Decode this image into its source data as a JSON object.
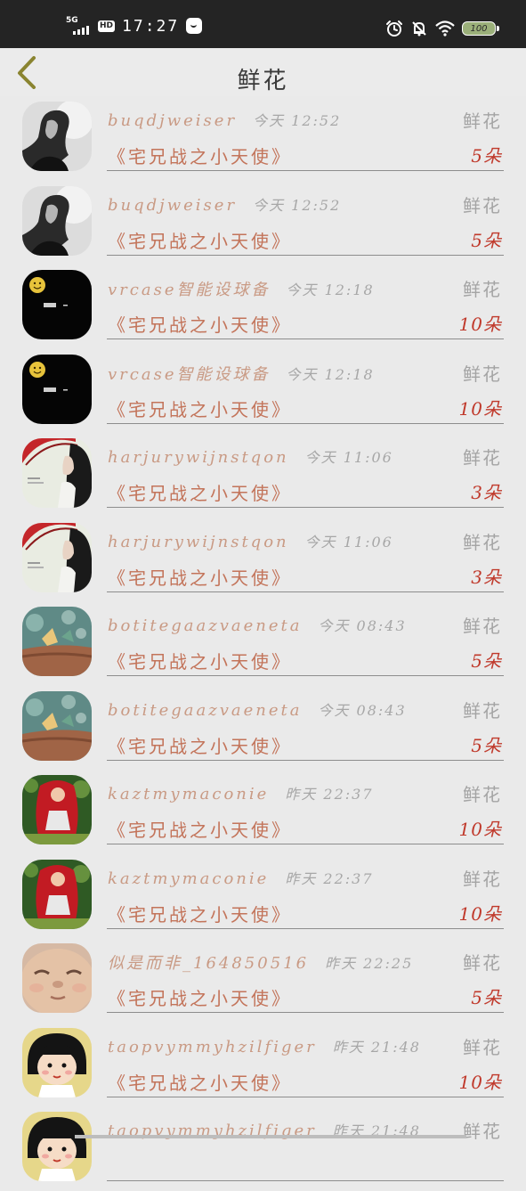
{
  "status_bar": {
    "network": "5G",
    "hd": "HD",
    "time": "17:27",
    "battery": "100",
    "icons": [
      "signal-icon",
      "hd-icon",
      "message-icon",
      "alarm-icon",
      "notifications-off-icon",
      "wifi-icon",
      "battery-icon"
    ]
  },
  "header": {
    "title": "鲜花",
    "back_icon": "chevron-left-icon"
  },
  "colors": {
    "name": "#c99a84",
    "gift_name": "#c3745a",
    "count": "#c0392b",
    "meta": "#a7a7a7",
    "back_icon": "#8a8430"
  },
  "rows": [
    {
      "avatar": "bw-portrait",
      "name": "buqdjweiser",
      "time": "今天 12:52",
      "type": "鲜花",
      "gift": "《宅兄战之小天使》",
      "count": "5朵"
    },
    {
      "avatar": "bw-portrait",
      "name": "buqdjweiser",
      "time": "今天 12:52",
      "type": "鲜花",
      "gift": "《宅兄战之小天使》",
      "count": "5朵"
    },
    {
      "avatar": "black-emoji",
      "name": "vrcase智能设球备",
      "time": "今天 12:18",
      "type": "鲜花",
      "gift": "《宅兄战之小天使》",
      "count": "10朵"
    },
    {
      "avatar": "black-emoji",
      "name": "vrcase智能设球备",
      "time": "今天 12:18",
      "type": "鲜花",
      "gift": "《宅兄战之小天使》",
      "count": "10朵"
    },
    {
      "avatar": "girl-red-umbrella",
      "name": "harjurywijnstqon",
      "time": "今天 11:06",
      "type": "鲜花",
      "gift": "《宅兄战之小天使》",
      "count": "3朵"
    },
    {
      "avatar": "girl-red-umbrella",
      "name": "harjurywijnstqon",
      "time": "今天 11:06",
      "type": "鲜花",
      "gift": "《宅兄战之小天使》",
      "count": "3朵"
    },
    {
      "avatar": "teal-bokeh",
      "name": "botitegaazvaeneta",
      "time": "今天 08:43",
      "type": "鲜花",
      "gift": "《宅兄战之小天使》",
      "count": "5朵"
    },
    {
      "avatar": "teal-bokeh",
      "name": "botitegaazvaeneta",
      "time": "今天 08:43",
      "type": "鲜花",
      "gift": "《宅兄战之小天使》",
      "count": "5朵"
    },
    {
      "avatar": "red-riding-hood",
      "name": "kaztmymaconie",
      "time": "昨天 22:37",
      "type": "鲜花",
      "gift": "《宅兄战之小天使》",
      "count": "10朵"
    },
    {
      "avatar": "red-riding-hood",
      "name": "kaztmymaconie",
      "time": "昨天 22:37",
      "type": "鲜花",
      "gift": "《宅兄战之小天使》",
      "count": "10朵"
    },
    {
      "avatar": "baby-face",
      "name": "似是而非_164850516",
      "time": "昨天 22:25",
      "type": "鲜花",
      "gift": "《宅兄战之小天使》",
      "count": "5朵"
    },
    {
      "avatar": "cartoon-girl",
      "name": "taopvymmyhzilfiger",
      "time": "昨天 21:48",
      "type": "鲜花",
      "gift": "《宅兄战之小天使》",
      "count": "10朵"
    },
    {
      "avatar": "cartoon-girl",
      "name": "taopvymmyhzilfiger",
      "time": "昨天 21:48",
      "type": "鲜花",
      "gift": "",
      "count": ""
    }
  ]
}
